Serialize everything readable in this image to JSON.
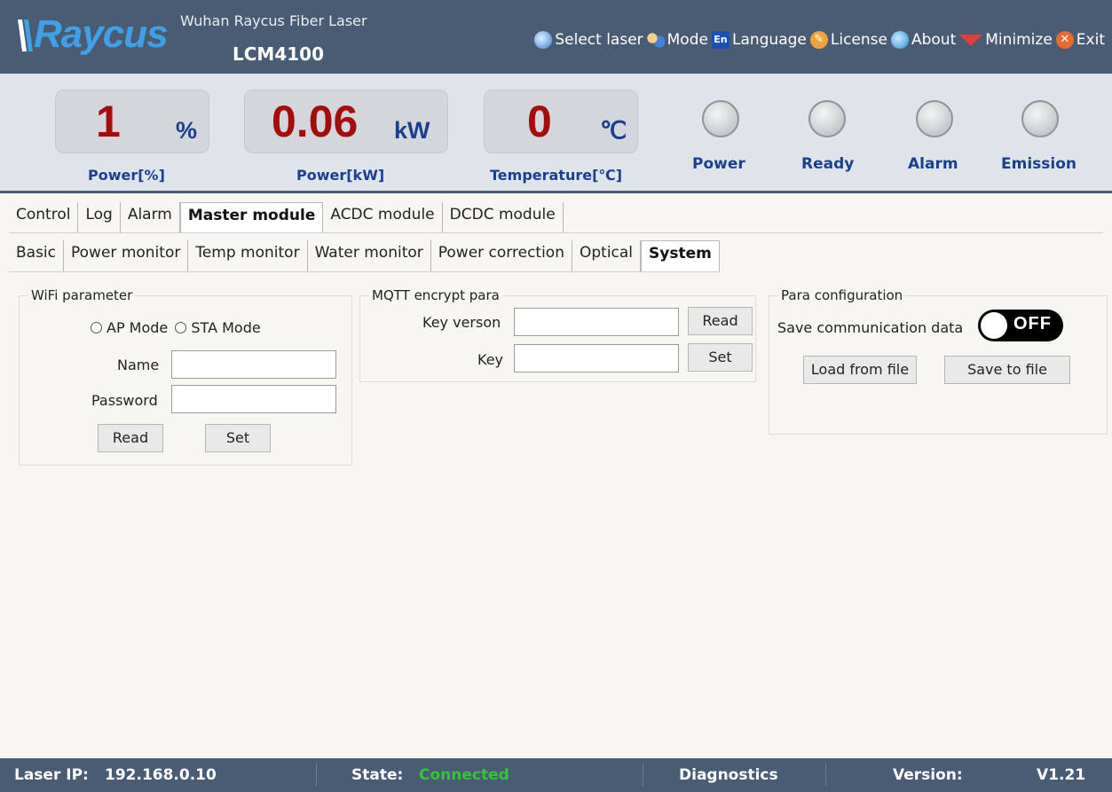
{
  "header": {
    "logo_text": "Raycus",
    "company": "Wuhan Raycus Fiber Laser",
    "model": "LCM4100",
    "menu": [
      {
        "label": "Select laser",
        "icon": "globe-icon"
      },
      {
        "label": "Mode",
        "icon": "users-icon"
      },
      {
        "label": "Language",
        "icon": "language-icon"
      },
      {
        "label": "License",
        "icon": "license-icon"
      },
      {
        "label": "About",
        "icon": "info-icon"
      },
      {
        "label": "Minimize",
        "icon": "minimize-icon"
      },
      {
        "label": "Exit",
        "icon": "close-icon"
      }
    ]
  },
  "readouts": [
    {
      "value": "1",
      "unit": "%",
      "label": "Power[%]"
    },
    {
      "value": "0.06",
      "unit": "kW",
      "label": "Power[kW]"
    },
    {
      "value": "0",
      "unit": "℃",
      "label": "Temperature[℃]"
    }
  ],
  "indicators": [
    {
      "label": "Power"
    },
    {
      "label": "Ready"
    },
    {
      "label": "Alarm"
    },
    {
      "label": "Emission"
    }
  ],
  "tabs_main": [
    "Control",
    "Log",
    "Alarm",
    "Master module",
    "ACDC module",
    "DCDC module"
  ],
  "tabs_main_active": "Master module",
  "tabs_sub": [
    "Basic",
    "Power monitor",
    "Temp monitor",
    "Water monitor",
    "Power correction",
    "Optical",
    "System"
  ],
  "tabs_sub_active": "System",
  "wifi": {
    "title": "WiFi parameter",
    "ap_mode": "AP Mode",
    "sta_mode": "STA Mode",
    "name_label": "Name",
    "name_value": "",
    "password_label": "Password",
    "password_value": "",
    "read_btn": "Read",
    "set_btn": "Set"
  },
  "mqtt": {
    "title": "MQTT encrypt para",
    "key_version_label": "Key verson",
    "key_version_value": "",
    "key_label": "Key",
    "key_value": "",
    "read_btn": "Read",
    "set_btn": "Set"
  },
  "para": {
    "title": "Para configuration",
    "save_comm_label": "Save communication data",
    "toggle_state": "OFF",
    "load_btn": "Load from file",
    "save_btn": "Save to file"
  },
  "footer": {
    "ip_label": "Laser IP:",
    "ip_value": "192.168.0.10",
    "state_label": "State:",
    "state_value": "Connected",
    "diagnostics": "Diagnostics",
    "version_label": "Version:",
    "version_value": "V1.21"
  },
  "colors": {
    "header_bg": "#4a5c73",
    "readout_value": "#a30d0d",
    "readout_unit": "#1b3f8e",
    "connected": "#34c43a"
  }
}
